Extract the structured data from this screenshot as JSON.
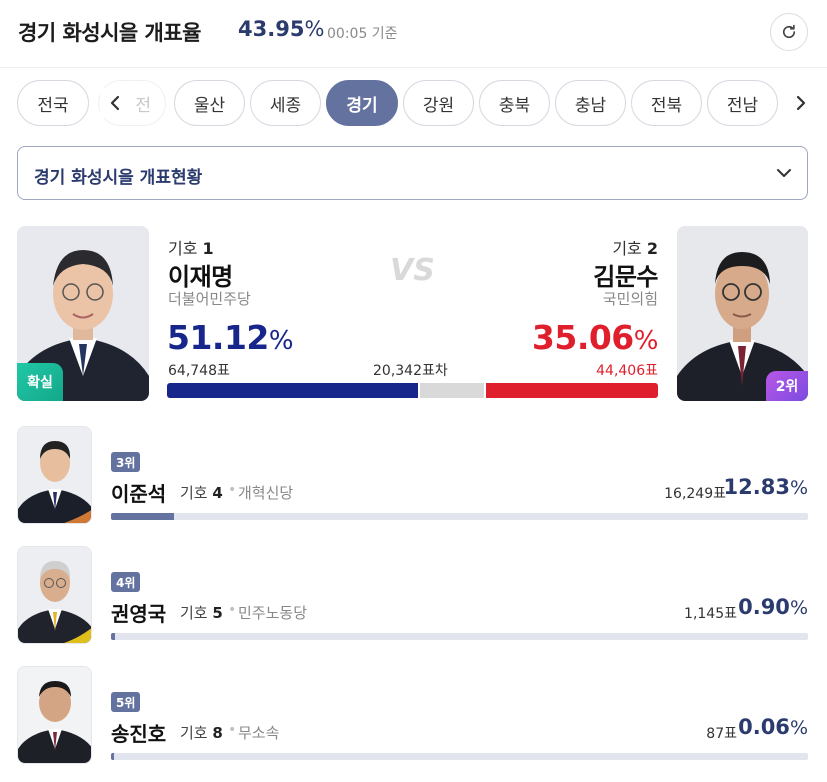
{
  "header": {
    "title": "경기 화성시을 개표율",
    "count_rate": "43.95",
    "count_rate_unit": "%",
    "time": "00:05 기준"
  },
  "tabs": [
    {
      "label": "전국",
      "state": "normal"
    },
    {
      "label": "전",
      "state": "faded"
    },
    {
      "label": "울산",
      "state": "normal"
    },
    {
      "label": "세종",
      "state": "normal"
    },
    {
      "label": "경기",
      "state": "active"
    },
    {
      "label": "강원",
      "state": "normal"
    },
    {
      "label": "충북",
      "state": "normal"
    },
    {
      "label": "충남",
      "state": "normal"
    },
    {
      "label": "전북",
      "state": "normal"
    },
    {
      "label": "전남",
      "state": "normal"
    }
  ],
  "dropdown": {
    "label": "경기 화성시을 개표현황"
  },
  "main": {
    "vs_label": "VS",
    "gap_label": "20,342표차",
    "left": {
      "number_prefix": "기호",
      "number": "1",
      "name": "이재명",
      "party": "더불어민주당",
      "pct": "51.12",
      "pct_unit": "%",
      "votes": "64,748표",
      "badge": "확실",
      "color": "#17268a",
      "share": 0.5112
    },
    "right": {
      "number_prefix": "기호",
      "number": "2",
      "name": "김문수",
      "party": "국민의힘",
      "pct": "35.06",
      "pct_unit": "%",
      "votes": "44,406표",
      "badge": "2위",
      "color": "#e01f2c",
      "share": 0.3506
    }
  },
  "others": [
    {
      "rank": "3위",
      "name": "이준석",
      "number_prefix": "기호",
      "number": "4",
      "party": "개혁신당",
      "votes": "16,249표",
      "pct": "12.83",
      "pct_unit": "%",
      "share": 0.1283
    },
    {
      "rank": "4위",
      "name": "권영국",
      "number_prefix": "기호",
      "number": "5",
      "party": "민주노동당",
      "votes": "1,145표",
      "pct": "0.90",
      "pct_unit": "%",
      "share": 0.009
    },
    {
      "rank": "5위",
      "name": "송진호",
      "number_prefix": "기호",
      "number": "8",
      "party": "무소속",
      "votes": "87표",
      "pct": "0.06",
      "pct_unit": "%",
      "share": 0.0006
    }
  ],
  "colors": {
    "accent": "#6472a0",
    "navy": "#2b3b6e",
    "win_badge": "#13a78a",
    "rank2_badge": "#7b4be0"
  }
}
